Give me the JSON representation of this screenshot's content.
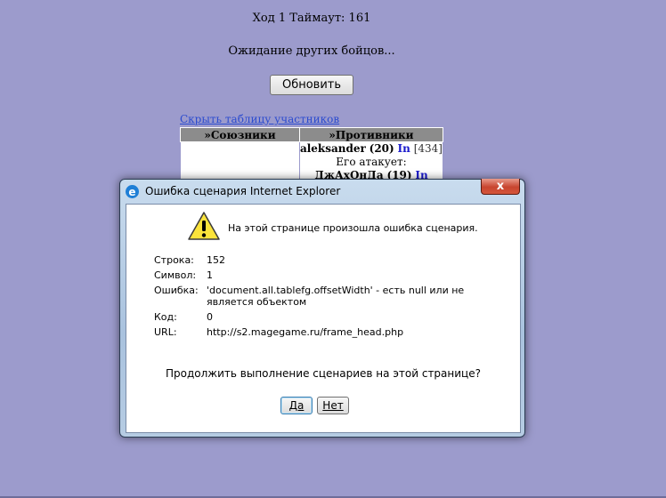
{
  "header": {
    "turn_info": "Ход 1 Таймаут: 161",
    "waiting": "Ожидание других бойцов...",
    "refresh_button": "Обновить",
    "hide_table_link": "Скрыть таблицу участников"
  },
  "table": {
    "allies_header": "»Союзники",
    "enemies_header": "»Противники",
    "enemy_name": "aleksander",
    "enemy_level": "(20)",
    "enemy_in": "In",
    "enemy_hp": "[434]",
    "attacked_by_label": "Его атакует:",
    "attacker_name": "ДжАхОнДа",
    "attacker_level": "(19)",
    "attacker_in": "In"
  },
  "dialog": {
    "title": "Ошибка сценария Internet Explorer",
    "close_label": "x",
    "headline": "На этой странице произошла ошибка сценария.",
    "line_label": "Строка:",
    "line_value": "152",
    "char_label": "Символ:",
    "char_value": "1",
    "error_label": "Ошибка:",
    "error_value": "'document.all.tablefg.offsetWidth' -  есть null или не является объектом",
    "code_label": "Код:",
    "code_value": "0",
    "url_label": "URL:",
    "url_value": "http://s2.magegame.ru/frame_head.php",
    "question": "Продолжить выполнение сценариев на этой странице?",
    "yes_button": "Да",
    "no_button": "Нет"
  },
  "icons": {
    "ie": "internet-explorer-icon",
    "warning": "warning-icon",
    "close": "close-icon"
  },
  "colors": {
    "page_background": "#9c9bcc",
    "link": "#2b4bcf",
    "in_marker": "#1a1acc",
    "close_button": "#c8452f"
  }
}
